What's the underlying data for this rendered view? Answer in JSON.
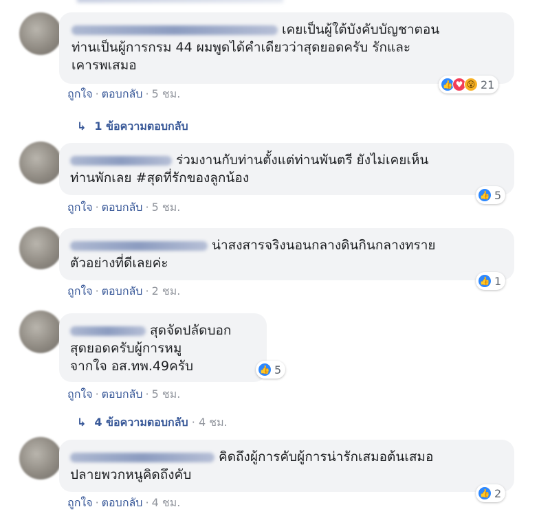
{
  "comments": [
    {
      "text": "เคยเป็นผู้ใต้บังคับบัญชาตอน\nท่านเป็นผู้การกรม 44 ผมพูดได้คำเดียวว่าสุดยอดครับ รักและ\nเคารพเสมอ",
      "like": "ถูกใจ",
      "reply": "ตอบกลับ",
      "time": "5 ชม.",
      "reaction_count": "21",
      "reaction_icons": [
        "like-icon",
        "love-icon",
        "wow-icon"
      ]
    },
    {
      "text": "ร่วมงานกับท่านตั้งแต่ท่านพันตรี ยังไม่เคยเห็น\nท่านพักเลย #สุดที่รักของลูกน้อง",
      "like": "ถูกใจ",
      "reply": "ตอบกลับ",
      "time": "5 ชม.",
      "reaction_count": "5",
      "reaction_icons": [
        "like-icon"
      ]
    },
    {
      "text": "น่าสงสารจริงนอนกลางดินกินกลางทราย\nตัวอย่างที่ดีเลยค่ะ",
      "like": "ถูกใจ",
      "reply": "ตอบกลับ",
      "time": "2 ชม.",
      "reaction_count": "1",
      "reaction_icons": [
        "like-icon"
      ]
    },
    {
      "text": "สุดจัดปลัดบอก\nสุดยอดครับผู้การหมู\nจากใจ อส.ทพ.49ครับ",
      "like": "ถูกใจ",
      "reply": "ตอบกลับ",
      "time": "5 ชม.",
      "reaction_count": "5",
      "reaction_icons": [
        "like-icon"
      ]
    },
    {
      "text": "คิดถึงผู้การคับผู้การน่ารักเสมอต้นเสมอ\nปลายพวกหนูคิดถึงคับ",
      "like": "ถูกใจ",
      "reply": "ตอบกลับ",
      "time": "4 ชม.",
      "reaction_count": "2",
      "reaction_icons": [
        "like-icon"
      ]
    }
  ],
  "replies": [
    {
      "label": "1 ข้อความตอบกลับ",
      "time": ""
    },
    {
      "label": "4 ข้อความตอบกลับ",
      "time": "4 ชม."
    }
  ],
  "colors": {
    "link": "#385898",
    "bubble": "#f2f3f5",
    "like": "#2d88ff",
    "love": "#f33e58",
    "wow": "#f7b125"
  }
}
